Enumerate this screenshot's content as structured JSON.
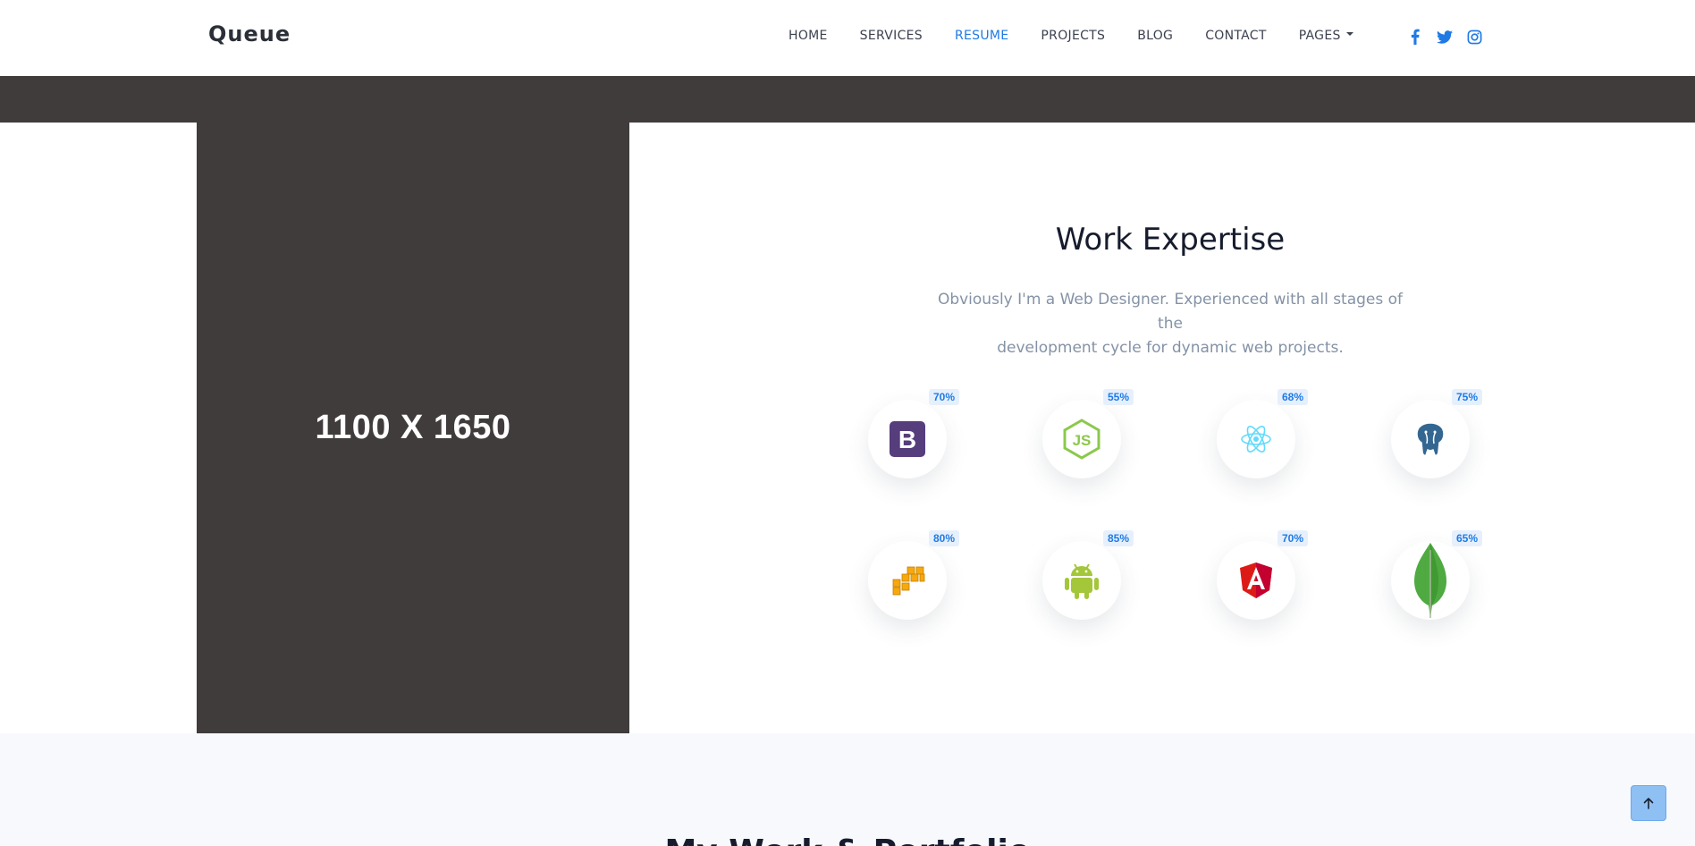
{
  "brand": "Queue",
  "nav": {
    "home": "HOME",
    "services": "SERVICES",
    "resume": "RESUME",
    "projects": "PROJECTS",
    "blog": "BLOG",
    "contact": "CONTACT",
    "pages": "PAGES"
  },
  "socials": [
    "facebook-icon",
    "twitter-icon",
    "instagram-icon"
  ],
  "placeholder": "1100 X 1650",
  "expertise": {
    "title": "Work Expertise",
    "description_line1": "Obviously I'm a Web Designer. Experienced with all stages of the",
    "description_line2": "development cycle for dynamic web projects.",
    "skills": [
      {
        "icon": "bootstrap-icon",
        "percent": "70%"
      },
      {
        "icon": "nodejs-icon",
        "percent": "55%"
      },
      {
        "icon": "react-icon",
        "percent": "68%"
      },
      {
        "icon": "postgresql-icon",
        "percent": "75%"
      },
      {
        "icon": "aws-icon",
        "percent": "80%"
      },
      {
        "icon": "android-icon",
        "percent": "85%"
      },
      {
        "icon": "angular-icon",
        "percent": "70%"
      },
      {
        "icon": "mongodb-icon",
        "percent": "65%"
      }
    ]
  },
  "portfolio": {
    "title": "My Work & Portfolio"
  },
  "colors": {
    "accent": "#1f7ae6",
    "dark": "#403c3b",
    "muted": "#8492a6"
  }
}
